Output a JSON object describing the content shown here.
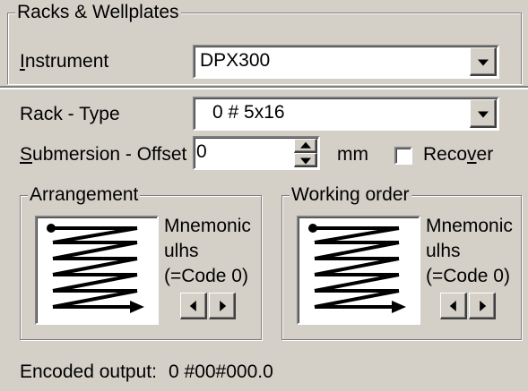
{
  "racks_group": {
    "title": "Racks & Wellplates",
    "instrument_label": "Instrument",
    "instrument_value": "DPX300"
  },
  "rack_type": {
    "label": "Rack - Type",
    "value": "0 # 5x16"
  },
  "submersion": {
    "label": "Submersion - Offset",
    "value": "0",
    "unit": "mm"
  },
  "recover": {
    "label": "Recover",
    "checked": false
  },
  "arrangement": {
    "title": "Arrangement",
    "line1": "Mnemonic",
    "line2": "ulhs",
    "line3": "(=Code 0)"
  },
  "working_order": {
    "title": "Working order",
    "line1": "Mnemonic",
    "line2": "ulhs",
    "line3": "(=Code 0)"
  },
  "encoded": {
    "label": "Encoded output:",
    "value": "0 #00#000.0"
  },
  "icons": {
    "combo_arrow": "chevron-down-icon",
    "spin_up": "arrow-up-icon",
    "spin_down": "arrow-down-icon",
    "prev": "arrow-left-icon",
    "next": "arrow-right-icon",
    "pattern": "zigzag-path-icon"
  }
}
